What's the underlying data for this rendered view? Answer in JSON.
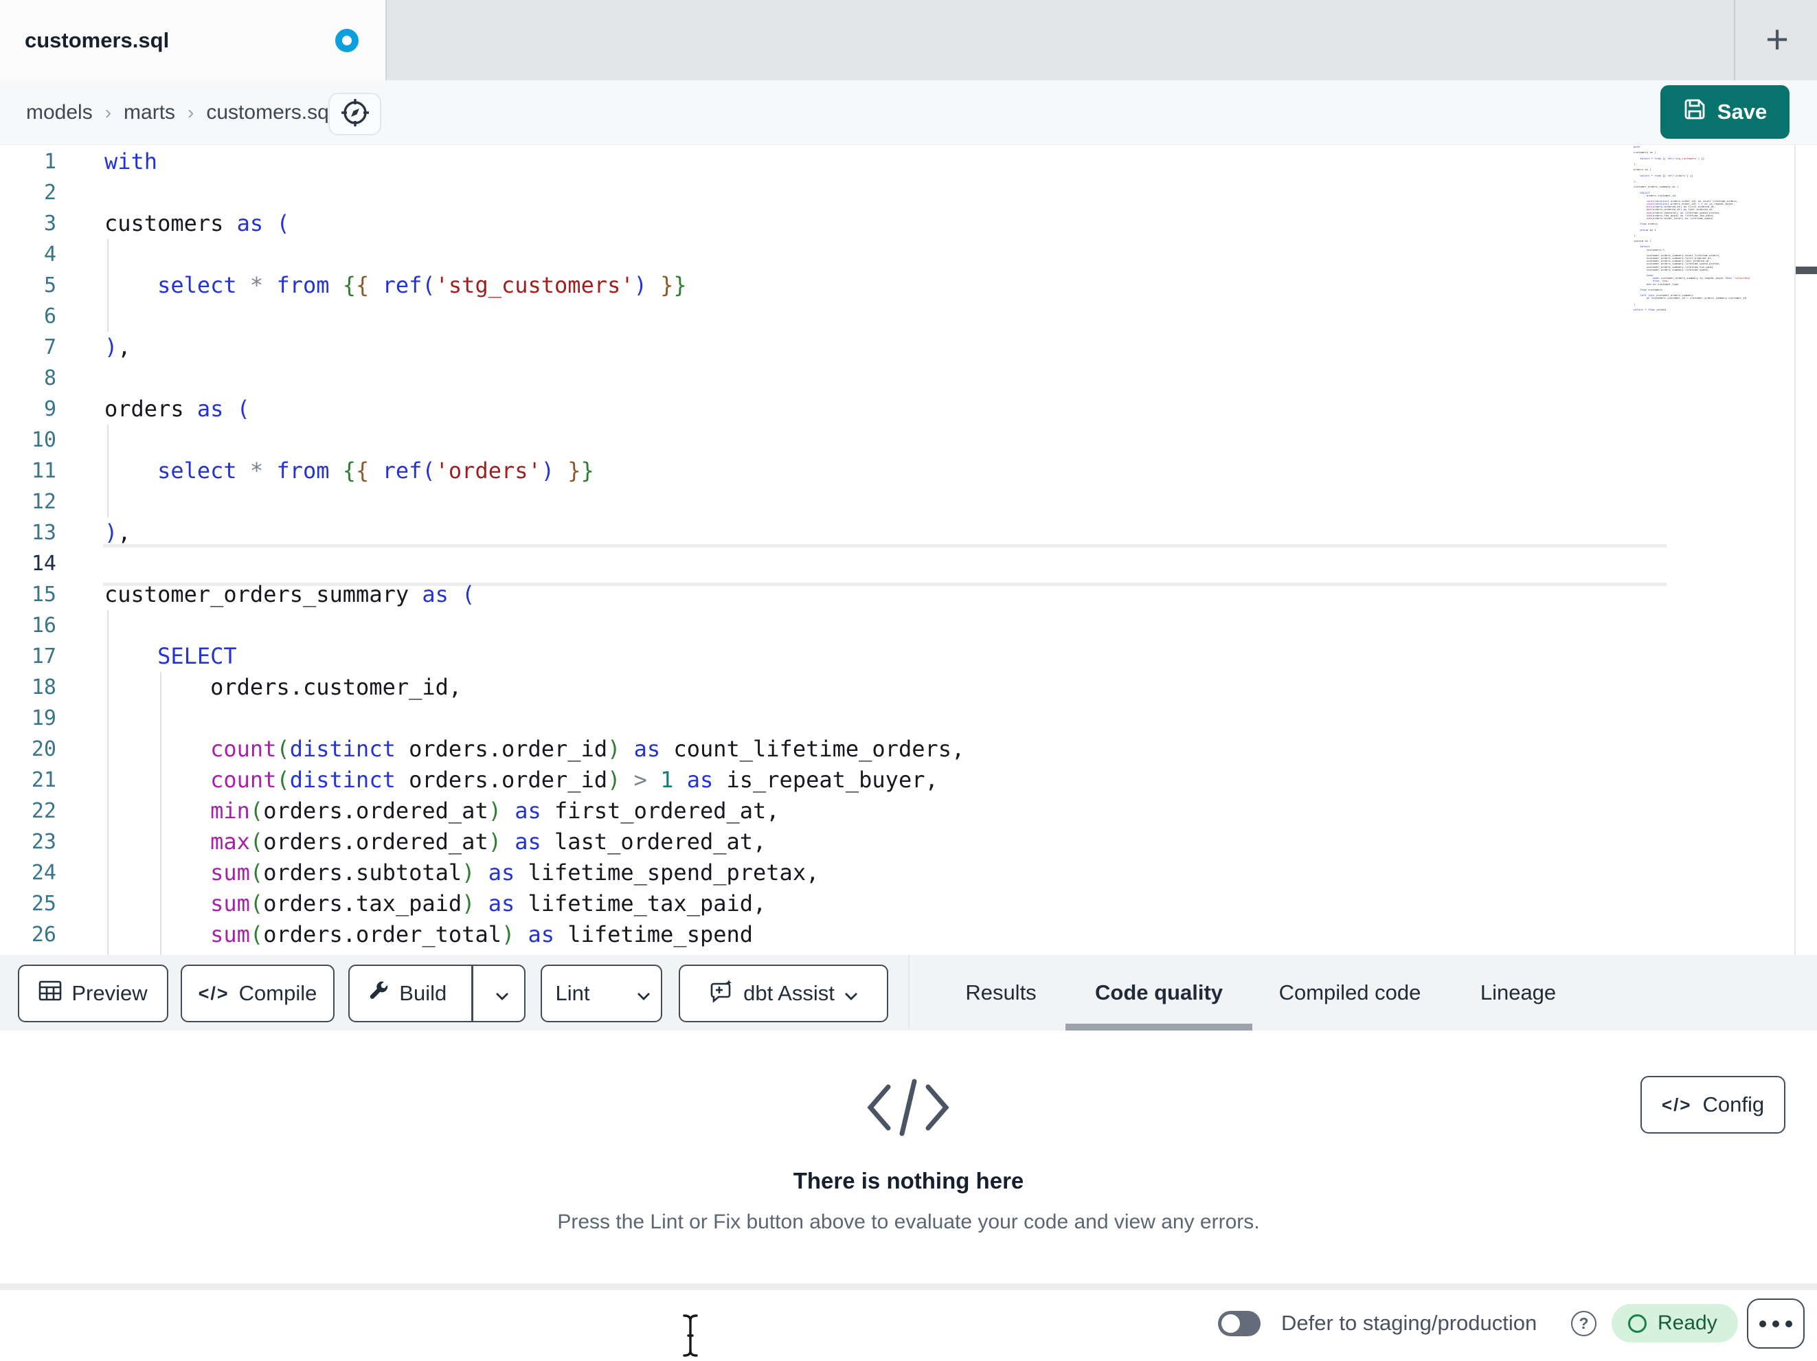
{
  "window": {
    "tab_title": "customers.sql",
    "unsaved_indicator": true,
    "new_tab_icon": "+"
  },
  "breadcrumb": {
    "items": [
      "models",
      "marts",
      "customers.sql"
    ],
    "separator": "›"
  },
  "save_button": {
    "label": "Save"
  },
  "editor": {
    "active_line": 14,
    "lines": [
      {
        "n": 1,
        "t": [
          [
            "with",
            "k"
          ]
        ]
      },
      {
        "n": 2,
        "t": []
      },
      {
        "n": 3,
        "t": [
          [
            "customers ",
            "p"
          ],
          [
            "as ",
            "k"
          ],
          [
            "(",
            "k"
          ]
        ]
      },
      {
        "n": 4,
        "t": []
      },
      {
        "n": 5,
        "t": [
          [
            "    ",
            "p"
          ],
          [
            "select ",
            "k"
          ],
          [
            "*",
            "o"
          ],
          [
            " ",
            "p"
          ],
          [
            "from ",
            "k"
          ],
          [
            "{",
            "g"
          ],
          [
            "{",
            "b"
          ],
          [
            " ",
            "p"
          ],
          [
            "ref",
            "k"
          ],
          [
            "(",
            "k"
          ],
          [
            "'stg_customers'",
            "s"
          ],
          [
            ")",
            "k"
          ],
          [
            " ",
            "p"
          ],
          [
            "}",
            "b"
          ],
          [
            "}",
            "g"
          ]
        ]
      },
      {
        "n": 6,
        "t": []
      },
      {
        "n": 7,
        "t": [
          [
            ")",
            "k"
          ],
          [
            ",",
            "p"
          ]
        ]
      },
      {
        "n": 8,
        "t": []
      },
      {
        "n": 9,
        "t": [
          [
            "orders ",
            "p"
          ],
          [
            "as ",
            "k"
          ],
          [
            "(",
            "k"
          ]
        ]
      },
      {
        "n": 10,
        "t": []
      },
      {
        "n": 11,
        "t": [
          [
            "    ",
            "p"
          ],
          [
            "select ",
            "k"
          ],
          [
            "*",
            "o"
          ],
          [
            " ",
            "p"
          ],
          [
            "from ",
            "k"
          ],
          [
            "{",
            "g"
          ],
          [
            "{",
            "b"
          ],
          [
            " ",
            "p"
          ],
          [
            "ref",
            "k"
          ],
          [
            "(",
            "k"
          ],
          [
            "'orders'",
            "s"
          ],
          [
            ")",
            "k"
          ],
          [
            " ",
            "p"
          ],
          [
            "}",
            "b"
          ],
          [
            "}",
            "g"
          ]
        ]
      },
      {
        "n": 12,
        "t": []
      },
      {
        "n": 13,
        "t": [
          [
            ")",
            "k"
          ],
          [
            ",",
            "p"
          ]
        ]
      },
      {
        "n": 14,
        "t": []
      },
      {
        "n": 15,
        "t": [
          [
            "customer_orders_summary ",
            "p"
          ],
          [
            "as ",
            "k"
          ],
          [
            "(",
            "k"
          ]
        ]
      },
      {
        "n": 16,
        "t": []
      },
      {
        "n": 17,
        "t": [
          [
            "    ",
            "p"
          ],
          [
            "SELECT",
            "k"
          ]
        ]
      },
      {
        "n": 18,
        "t": [
          [
            "        orders.customer_id,",
            "p"
          ]
        ]
      },
      {
        "n": 19,
        "t": []
      },
      {
        "n": 20,
        "t": [
          [
            "        ",
            "p"
          ],
          [
            "count",
            "f"
          ],
          [
            "(",
            "g"
          ],
          [
            "distinct ",
            "k"
          ],
          [
            "orders.order_id",
            "p"
          ],
          [
            ")",
            "g"
          ],
          [
            " ",
            "p"
          ],
          [
            "as ",
            "k"
          ],
          [
            "count_lifetime_orders,",
            "p"
          ]
        ]
      },
      {
        "n": 21,
        "t": [
          [
            "        ",
            "p"
          ],
          [
            "count",
            "f"
          ],
          [
            "(",
            "g"
          ],
          [
            "distinct ",
            "k"
          ],
          [
            "orders.order_id",
            "p"
          ],
          [
            ")",
            "g"
          ],
          [
            " ",
            "p"
          ],
          [
            "> ",
            "o"
          ],
          [
            "1 ",
            "n"
          ],
          [
            "as ",
            "k"
          ],
          [
            "is_repeat_buyer,",
            "p"
          ]
        ]
      },
      {
        "n": 22,
        "t": [
          [
            "        ",
            "p"
          ],
          [
            "min",
            "f"
          ],
          [
            "(",
            "g"
          ],
          [
            "orders.ordered_at",
            "p"
          ],
          [
            ")",
            "g"
          ],
          [
            " ",
            "p"
          ],
          [
            "as ",
            "k"
          ],
          [
            "first_ordered_at,",
            "p"
          ]
        ]
      },
      {
        "n": 23,
        "t": [
          [
            "        ",
            "p"
          ],
          [
            "max",
            "f"
          ],
          [
            "(",
            "g"
          ],
          [
            "orders.ordered_at",
            "p"
          ],
          [
            ")",
            "g"
          ],
          [
            " ",
            "p"
          ],
          [
            "as ",
            "k"
          ],
          [
            "last_ordered_at,",
            "p"
          ]
        ]
      },
      {
        "n": 24,
        "t": [
          [
            "        ",
            "p"
          ],
          [
            "sum",
            "f"
          ],
          [
            "(",
            "g"
          ],
          [
            "orders.subtotal",
            "p"
          ],
          [
            ")",
            "g"
          ],
          [
            " ",
            "p"
          ],
          [
            "as ",
            "k"
          ],
          [
            "lifetime_spend_pretax,",
            "p"
          ]
        ]
      },
      {
        "n": 25,
        "t": [
          [
            "        ",
            "p"
          ],
          [
            "sum",
            "f"
          ],
          [
            "(",
            "g"
          ],
          [
            "orders.tax_paid",
            "p"
          ],
          [
            ")",
            "g"
          ],
          [
            " ",
            "p"
          ],
          [
            "as ",
            "k"
          ],
          [
            "lifetime_tax_paid,",
            "p"
          ]
        ]
      },
      {
        "n": 26,
        "t": [
          [
            "        ",
            "p"
          ],
          [
            "sum",
            "f"
          ],
          [
            "(",
            "g"
          ],
          [
            "orders.order_total",
            "p"
          ],
          [
            ")",
            "g"
          ],
          [
            " ",
            "p"
          ],
          [
            "as ",
            "k"
          ],
          [
            "lifetime_spend",
            "p"
          ]
        ]
      }
    ]
  },
  "minimap": {
    "lines": [
      "with",
      "",
      "customers as (",
      "",
      "    select * from {{ ref('stg_customers') }}",
      "",
      "),",
      "",
      "orders as (",
      "",
      "    select * from {{ ref('orders') }}",
      "",
      "),",
      "",
      "customer_orders_summary as (",
      "",
      "    SELECT",
      "        orders.customer_id,",
      "",
      "        count(distinct orders.order_id) as count_lifetime_orders,",
      "        count(distinct orders.order_id) > 1 as is_repeat_buyer,",
      "        min(orders.ordered_at) as first_ordered_at,",
      "        max(orders.ordered_at) as last_ordered_at,",
      "        sum(orders.subtotal) as lifetime_spend_pretax,",
      "        sum(orders.tax_paid) as lifetime_tax_paid,",
      "        sum(orders.order_total) as lifetime_spend",
      "",
      "    from orders",
      "",
      "    group by 1",
      "",
      "),",
      "",
      "joined as (",
      "",
      "    select",
      "        customers.*,",
      "",
      "        customer_orders_summary.count_lifetime_orders,",
      "        customer_orders_summary.first_ordered_at,",
      "        customer_orders_summary.last_ordered_at,",
      "        customer_orders_summary.lifetime_spend_pretax,",
      "        customer_orders_summary.lifetime_tax_paid,",
      "        customer_orders_summary.lifetime_spend,",
      "",
      "        case",
      "            when customer_orders_summary.is_repeat_buyer then 'returning'",
      "            else 'new'",
      "        end as customer_type",
      "",
      "    from customers",
      "",
      "    left join customer_orders_summary",
      "        on customers.customer_id = customer_orders_summary.customer_id",
      "",
      ")",
      "",
      "select * from joined"
    ]
  },
  "toolbar": {
    "preview_label": "Preview",
    "compile_label": "Compile",
    "compile_icon": "</>",
    "build_label": "Build",
    "lint_label": "Lint",
    "assist_label": "dbt Assist"
  },
  "result_tabs": {
    "tabs": [
      {
        "label": "Results",
        "active": false
      },
      {
        "label": "Code quality",
        "active": true
      },
      {
        "label": "Compiled code",
        "active": false
      },
      {
        "label": "Lineage",
        "active": false
      }
    ]
  },
  "empty_state": {
    "icon": "</>",
    "title": "There is nothing here",
    "description": "Press the Lint or Fix button above to evaluate your code and view any errors."
  },
  "config_button": {
    "icon": "</>",
    "label": "Config"
  },
  "status_bar": {
    "defer_toggle_on": false,
    "defer_label": "Defer to staging/production",
    "help_icon": "?",
    "ready_label": "Ready"
  },
  "colors": {
    "save_button": "#07736c",
    "unsaved_dot": "#0aa0dd",
    "ready_badge_bg": "#d6f1dc",
    "ready_badge_text": "#185c3c",
    "active_tab_underline": "#9ba2ab",
    "keyword": "#2433d6",
    "function": "#a822a8",
    "string": "#9f1f1f"
  }
}
